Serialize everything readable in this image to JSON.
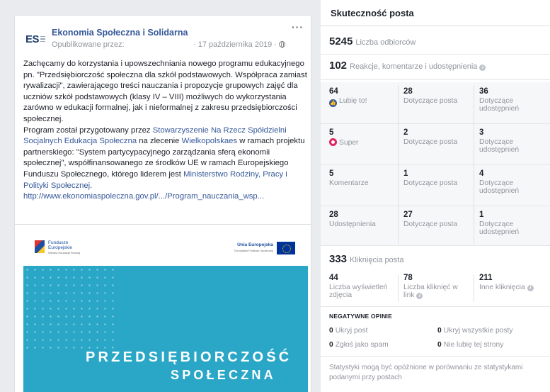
{
  "post": {
    "page_name": "Ekonomia Społeczna i Solidarna",
    "avatar_text": "ES",
    "published_by": "Opublikowane przez:",
    "date": "· 17 października 2019 ·",
    "more": "···",
    "text": {
      "p1": "Zachęcamy do korzystania i upowszechniania nowego programu edukacyjnego pn. \"Przedsiębiorczość społeczna dla szkół podstawowych. Współpraca zamiast rywalizacji\", zawierającego treści nauczania i propozycje grupowych zajęć dla uczniów szkół podstawowych (klasy IV – VIII) możliwych do wykorzystania zarówno w edukacji formalnej, jak i nieformalnej z zakresu przedsiębiorczości społecznej.",
      "p2_a": "Program został przygotowany przez ",
      "p2_link1": "Stowarzyszenie Na Rzecz Spółdzielni Socjalnych Edukacja Społeczna",
      "p2_b": " na zlecenie ",
      "p2_link2": "Wielkopolskaes",
      "p2_c": " w ramach projektu partnerskiego: \"System partycypacyjnego zarządzania sferą ekonomii społecznej\", współfinansowanego ze środków UE w ramach Europejskiego Funduszu Społecznego, którego liderem jest ",
      "p2_link3": "Ministerstwo Rodziny, Pracy i Polityki Społecznej.",
      "url": "http://www.ekonomiaspoleczna.gov.pl/.../Program_nauczania_wsp..."
    },
    "image": {
      "fe_line1": "Fundusze",
      "fe_line2": "Europejskie",
      "fe_sub": "Wiedza Edukacja Rozwój",
      "ue_line1": "Unia Europejska",
      "ue_sub": "Europejski Fundusz Społeczny",
      "title1": "PRZEDSIĘBIORCZOŚĆ",
      "title2": "SPOŁECZNA"
    }
  },
  "stats": {
    "title": "Skuteczność posta",
    "reach": {
      "value": "5245",
      "label": "Liczba odbiorców"
    },
    "engagement": {
      "value": "102",
      "label": "Reakcje, komentarze i udostępnienia"
    },
    "rows": [
      {
        "value": "64",
        "label": "Lubię to!",
        "post_value": "28",
        "post_label": "Dotyczące posta",
        "share_value": "36",
        "share_label": "Dotyczące udostępnień"
      },
      {
        "value": "5",
        "label": "Super",
        "post_value": "2",
        "post_label": "Dotyczące posta",
        "share_value": "3",
        "share_label": "Dotyczące udostępnień"
      },
      {
        "value": "5",
        "label": "Komentarze",
        "post_value": "1",
        "post_label": "Dotyczące posta",
        "share_value": "4",
        "share_label": "Dotyczące udostępnień"
      },
      {
        "value": "28",
        "label": "Udostępnienia",
        "post_value": "27",
        "post_label": "Dotyczące posta",
        "share_value": "1",
        "share_label": "Dotyczące udostępnień"
      }
    ],
    "clicks": {
      "value": "333",
      "label": "Kliknięcia posta"
    },
    "click_rows": [
      {
        "value": "44",
        "label": "Liczba wyświetleń zdjęcia"
      },
      {
        "value": "78",
        "label": "Liczba kliknięć w link"
      },
      {
        "value": "211",
        "label": "Inne kliknięcia"
      }
    ],
    "negative": {
      "title": "NEGATYWNE OPINIE",
      "items": [
        {
          "value": "0",
          "label": "Ukryj post"
        },
        {
          "value": "0",
          "label": "Ukryj wszystkie posty"
        },
        {
          "value": "0",
          "label": "Zgłoś jako spam"
        },
        {
          "value": "0",
          "label": "Nie lubię tej strony"
        }
      ]
    },
    "footer": "Statystyki mogą być opóźnione w porównaniu ze statystykami podanymi przy postach"
  }
}
